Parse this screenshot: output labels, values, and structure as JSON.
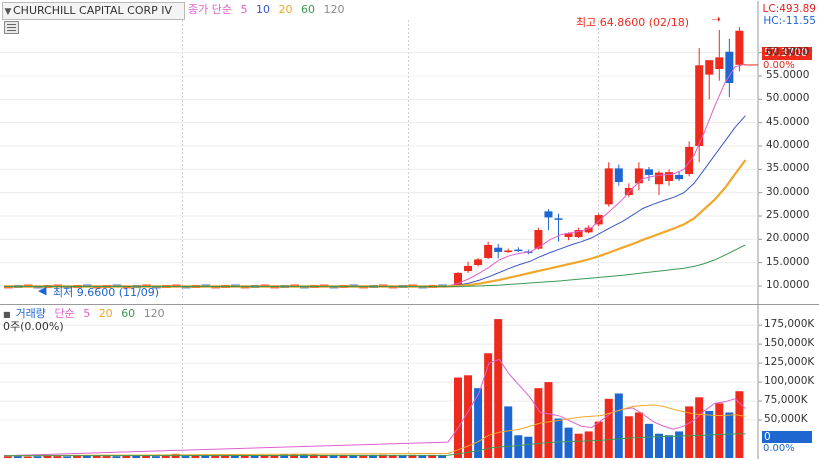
{
  "header": {
    "symbol": "CHURCHILL CAPITAL CORP IV",
    "ma_label": "종가 단순",
    "ma_periods": [
      "5",
      "10",
      "20",
      "60",
      "120"
    ]
  },
  "price_info": {
    "lc": "LC:493.89",
    "hc": "HC:-11.55",
    "last_price": "57.3700",
    "last_change": "0.00%",
    "high_annotation": "최고 64.8600 (02/18)",
    "low_annotation": "최저 9.6600 (11/09)"
  },
  "volume_panel": {
    "label": "거래량",
    "ma_label": "단순",
    "ma_periods": [
      "5",
      "20",
      "60",
      "120"
    ],
    "sub_label": "0주(0.00%)",
    "last_volume": "0",
    "last_change": "0.00%"
  },
  "colors": {
    "up": "#ee2a1c",
    "down": "#1e66d0",
    "ma5": "#e05fcf",
    "ma10": "#3a56c8",
    "ma20": "#f0a72a",
    "ma60": "#3a9a55",
    "ma120": "#8a8a8a"
  },
  "chart_data": [
    {
      "type": "candlestick",
      "title": "CHURCHILL CAPITAL CORP IV",
      "y_ticks": [
        10,
        15,
        20,
        25,
        30,
        35,
        40,
        45,
        50,
        55,
        60
      ],
      "y_tick_labels": [
        "10.0000",
        "15.0000",
        "20.0000",
        "25.0000",
        "30.0000",
        "35.0000",
        "40.0000",
        "45.0000",
        "50.0000",
        "55.0000",
        "60.0000"
      ],
      "ylim": [
        7.0,
        67.0
      ],
      "grid": true,
      "flat_period": {
        "count": 45,
        "value": 9.9
      },
      "candles": [
        {
          "o": 9.9,
          "h": 13.0,
          "l": 9.7,
          "c": 12.8
        },
        {
          "o": 13.2,
          "h": 15.2,
          "l": 12.8,
          "c": 14.3
        },
        {
          "o": 14.5,
          "h": 16.0,
          "l": 14.2,
          "c": 15.7
        },
        {
          "o": 16.0,
          "h": 19.5,
          "l": 15.8,
          "c": 18.8
        },
        {
          "o": 18.2,
          "h": 19.0,
          "l": 15.9,
          "c": 17.3
        },
        {
          "o": 17.4,
          "h": 18.0,
          "l": 17.1,
          "c": 17.6
        },
        {
          "o": 17.8,
          "h": 18.3,
          "l": 17.3,
          "c": 17.5
        },
        {
          "o": 17.4,
          "h": 17.8,
          "l": 16.8,
          "c": 17.3
        },
        {
          "o": 18.0,
          "h": 22.5,
          "l": 17.8,
          "c": 22.0
        },
        {
          "o": 26.0,
          "h": 26.5,
          "l": 22.0,
          "c": 24.7
        },
        {
          "o": 24.5,
          "h": 25.5,
          "l": 19.5,
          "c": 24.3
        },
        {
          "o": 20.5,
          "h": 21.5,
          "l": 19.8,
          "c": 21.3
        },
        {
          "o": 20.5,
          "h": 22.5,
          "l": 20.3,
          "c": 22.0
        },
        {
          "o": 21.5,
          "h": 23.0,
          "l": 21.3,
          "c": 22.5
        },
        {
          "o": 23.2,
          "h": 25.5,
          "l": 22.8,
          "c": 25.2
        },
        {
          "o": 27.5,
          "h": 36.5,
          "l": 27.0,
          "c": 35.2
        },
        {
          "o": 35.2,
          "h": 36.0,
          "l": 31.5,
          "c": 32.3
        },
        {
          "o": 29.5,
          "h": 32.0,
          "l": 29.0,
          "c": 31.0
        },
        {
          "o": 32.0,
          "h": 36.5,
          "l": 30.5,
          "c": 35.2
        },
        {
          "o": 35.0,
          "h": 35.5,
          "l": 32.5,
          "c": 33.8
        },
        {
          "o": 31.8,
          "h": 34.7,
          "l": 29.5,
          "c": 34.3
        },
        {
          "o": 32.5,
          "h": 35.0,
          "l": 31.5,
          "c": 34.4
        },
        {
          "o": 33.8,
          "h": 34.5,
          "l": 32.5,
          "c": 32.9
        },
        {
          "o": 34.0,
          "h": 41.0,
          "l": 33.5,
          "c": 39.8
        },
        {
          "o": 40.0,
          "h": 61.0,
          "l": 36.5,
          "c": 57.3
        },
        {
          "o": 55.3,
          "h": 58.0,
          "l": 50.0,
          "c": 58.4
        },
        {
          "o": 56.5,
          "h": 64.86,
          "l": 54.0,
          "c": 59.0
        },
        {
          "o": 60.2,
          "h": 63.0,
          "l": 50.5,
          "c": 53.5
        },
        {
          "o": 57.4,
          "h": 65.5,
          "l": 56.0,
          "c": 64.7
        }
      ],
      "ma_series": [
        {
          "name": "5",
          "values": [
            10.0,
            10.6,
            11.5,
            12.7,
            14.0,
            15.6,
            16.5,
            17.0,
            17.3,
            18.5,
            20.0,
            21.0,
            21.4,
            21.8,
            22.5,
            24.5,
            26.5,
            28.5,
            31.0,
            33.0,
            33.5,
            33.8,
            34.0,
            35.0,
            38.0,
            43.0,
            48.5,
            53.5,
            57.0,
            57.5
          ]
        },
        {
          "name": "10",
          "values": [
            9.95,
            10.2,
            10.6,
            11.2,
            12.0,
            12.9,
            13.8,
            14.6,
            15.3,
            16.3,
            17.2,
            18.0,
            18.8,
            19.5,
            20.3,
            21.5,
            22.7,
            23.8,
            25.2,
            26.6,
            27.5,
            28.3,
            29.0,
            30.0,
            32.0,
            35.0,
            38.0,
            41.0,
            44.0,
            46.5
          ]
        },
        {
          "name": "20",
          "values": [
            9.9,
            10.0,
            10.2,
            10.5,
            10.9,
            11.3,
            11.8,
            12.3,
            12.8,
            13.3,
            13.8,
            14.3,
            14.8,
            15.3,
            15.9,
            16.6,
            17.4,
            18.2,
            19.0,
            19.9,
            20.7,
            21.5,
            22.3,
            23.2,
            24.5,
            26.5,
            28.5,
            31.0,
            34.0,
            37.0
          ]
        },
        {
          "name": "60",
          "values": [
            9.9,
            9.9,
            9.95,
            10.0,
            10.1,
            10.2,
            10.35,
            10.5,
            10.65,
            10.8,
            10.95,
            11.1,
            11.3,
            11.5,
            11.7,
            11.9,
            12.1,
            12.3,
            12.55,
            12.8,
            13.05,
            13.3,
            13.55,
            13.8,
            14.2,
            14.8,
            15.6,
            16.6,
            17.7,
            18.8
          ]
        }
      ]
    },
    {
      "type": "bar",
      "title": "거래량",
      "y_ticks": [
        50000,
        75000,
        100000,
        125000,
        150000,
        175000
      ],
      "y_tick_labels": [
        "50,000K",
        "75,000K",
        "100,000K",
        "125,000K",
        "150,000K",
        "175,000K"
      ],
      "ylim": [
        0,
        195000
      ],
      "flat_values": [
        2000,
        2500,
        1800,
        2200,
        3000,
        2400,
        2000,
        2600,
        2800,
        3200,
        2500,
        2300,
        3100,
        3000,
        2700,
        2400,
        4500,
        5500,
        2500,
        3500,
        4000,
        2600,
        2900,
        3300,
        3000,
        2800,
        3500,
        3200,
        5000,
        5200,
        4800,
        4400,
        3600,
        4000,
        3500,
        3200,
        3000,
        3800,
        4200,
        3600,
        3900,
        4100,
        3800,
        4000,
        3700
      ],
      "flat_up": [
        true,
        false,
        true,
        false,
        true,
        true,
        false,
        true,
        false,
        true,
        true,
        false,
        true,
        false,
        true,
        false,
        true,
        true,
        false,
        true,
        false,
        true,
        true,
        false,
        true,
        false,
        true,
        true,
        false,
        true,
        false,
        true,
        true,
        false,
        true,
        false,
        true,
        false,
        true,
        true,
        false,
        true,
        false,
        true,
        false
      ],
      "bars": [
        {
          "v": 106000,
          "up": true
        },
        {
          "v": 109000,
          "up": true
        },
        {
          "v": 92000,
          "up": false
        },
        {
          "v": 138000,
          "up": true
        },
        {
          "v": 183000,
          "up": true
        },
        {
          "v": 68000,
          "up": false
        },
        {
          "v": 30000,
          "up": false
        },
        {
          "v": 28000,
          "up": false
        },
        {
          "v": 92000,
          "up": true
        },
        {
          "v": 100000,
          "up": true
        },
        {
          "v": 52000,
          "up": false
        },
        {
          "v": 40000,
          "up": false
        },
        {
          "v": 32000,
          "up": true
        },
        {
          "v": 35000,
          "up": true
        },
        {
          "v": 48000,
          "up": true
        },
        {
          "v": 78000,
          "up": true
        },
        {
          "v": 85000,
          "up": false
        },
        {
          "v": 55000,
          "up": true
        },
        {
          "v": 60000,
          "up": true
        },
        {
          "v": 45000,
          "up": false
        },
        {
          "v": 32000,
          "up": false
        },
        {
          "v": 30000,
          "up": false
        },
        {
          "v": 35000,
          "up": false
        },
        {
          "v": 68000,
          "up": true
        },
        {
          "v": 80000,
          "up": true
        },
        {
          "v": 62000,
          "up": false
        },
        {
          "v": 72000,
          "up": true
        },
        {
          "v": 60000,
          "up": false
        },
        {
          "v": 88000,
          "up": true
        }
      ],
      "ma_series": [
        {
          "name": "5",
          "values": [
            21000,
            40000,
            62000,
            85000,
            125000,
            130000,
            110000,
            95000,
            80000,
            60000,
            58000,
            55000,
            48000,
            42000,
            40000,
            50000,
            60000,
            64000,
            66000,
            58000,
            48000,
            42000,
            38000,
            42000,
            50000,
            62000,
            72000,
            74000,
            78000,
            65000
          ]
        },
        {
          "name": "20",
          "values": [
            6000,
            11000,
            16000,
            22000,
            30000,
            34000,
            36000,
            38000,
            42000,
            46000,
            48000,
            50000,
            52000,
            54000,
            55000,
            56000,
            60000,
            64000,
            68000,
            69000,
            70000,
            68000,
            64000,
            61000,
            58000,
            57000,
            56000,
            56000,
            57000,
            55000
          ]
        },
        {
          "name": "60",
          "values": [
            3500,
            5500,
            7500,
            9500,
            13000,
            14500,
            15500,
            16500,
            18000,
            19500,
            20500,
            21200,
            21800,
            22300,
            22800,
            23500,
            24500,
            25500,
            26500,
            27200,
            27800,
            28300,
            28700,
            29100,
            29500,
            30000,
            30600,
            31200,
            31800,
            32000
          ]
        }
      ]
    }
  ]
}
